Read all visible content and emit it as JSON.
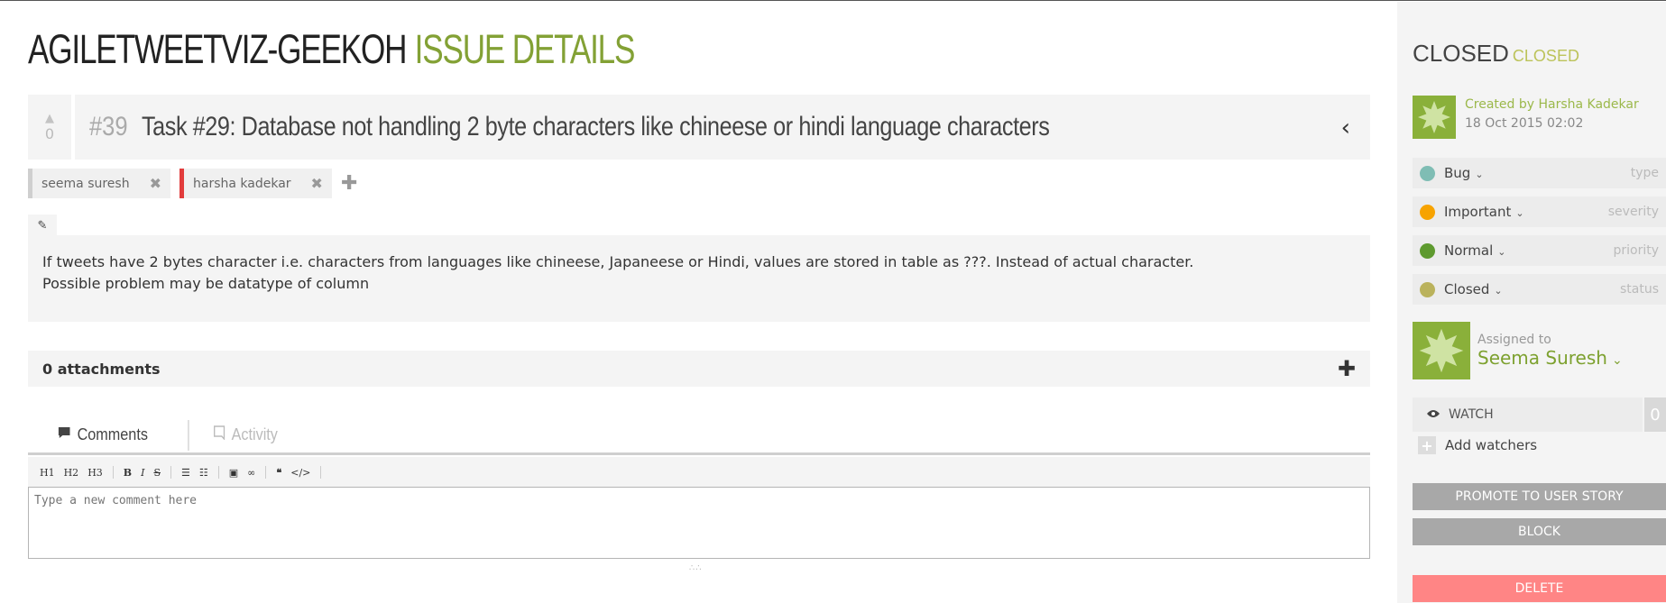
{
  "page": {
    "project": "AGILETWEETVIZ-GEEKOH",
    "section": "ISSUE DETAILS"
  },
  "issue": {
    "votes": "0",
    "ref": "#39",
    "subject": "Task #29: Database not handling 2 byte characters like chineese or hindi language characters",
    "tags": [
      {
        "label": "seema suresh",
        "color": "#cfcfcf"
      },
      {
        "label": "harsha kadekar",
        "color": "#e23c3c"
      }
    ],
    "description_lines": [
      "If tweets have 2 bytes character i.e. characters from languages like chineese, Japaneese or Hindi, values are stored in table as ???. Instead of actual character.",
      "Possible problem may be datatype of column"
    ]
  },
  "attachments": {
    "count": "0",
    "label": "attachments"
  },
  "tabs": {
    "comments": "Comments",
    "activity": "Activity"
  },
  "editor": {
    "toolbar": [
      "H1",
      "H2",
      "H3",
      "B",
      "I",
      "S",
      "ul",
      "ol",
      "img",
      "link",
      "quote",
      "code"
    ],
    "placeholder": "Type a new comment here"
  },
  "sidebar": {
    "status_main": "CLOSED",
    "status_sub": "CLOSED",
    "created_by": "Created by Harsha Kadekar",
    "created_date": "18 Oct 2015 02:02",
    "attributes": [
      {
        "value": "Bug",
        "kind": "type",
        "color": "#7fbdb4"
      },
      {
        "value": "Important",
        "kind": "severity",
        "color": "#f7a300"
      },
      {
        "value": "Normal",
        "kind": "priority",
        "color": "#5e9a2f"
      },
      {
        "value": "Closed",
        "kind": "status",
        "color": "#bab25c"
      }
    ],
    "assigned_label": "Assigned to",
    "assigned_name": "Seema Suresh",
    "watch_label": "WATCH",
    "watch_count": "0",
    "add_watchers": "Add watchers",
    "promote": "PROMOTE TO USER STORY",
    "block": "BLOCK",
    "delete": "DELETE"
  }
}
